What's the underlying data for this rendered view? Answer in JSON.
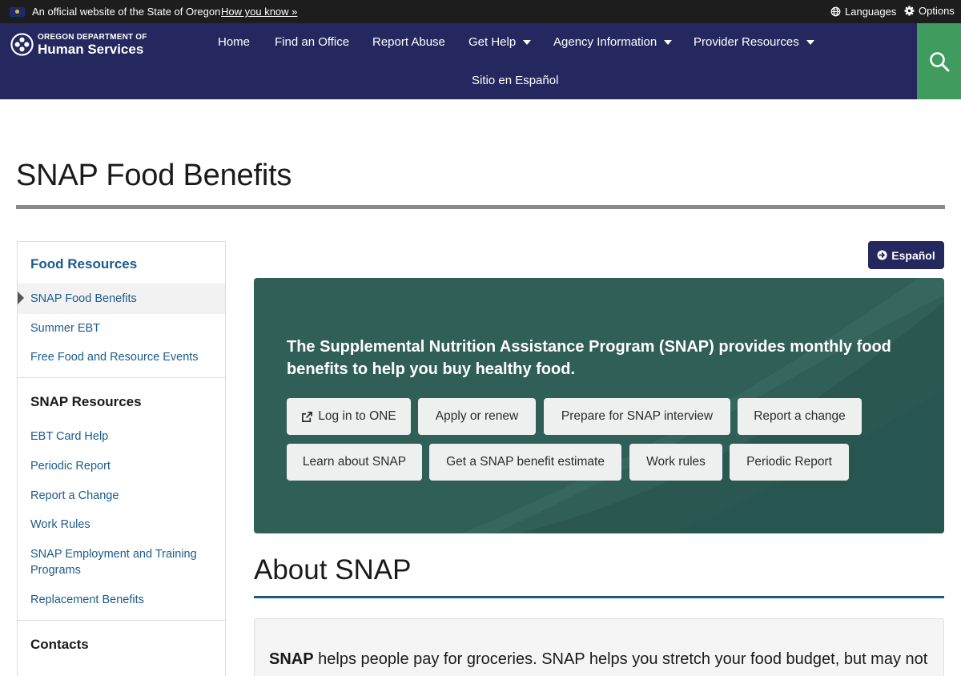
{
  "official_banner": {
    "text": "An official website of the State of Oregon",
    "how_link": "How you know »",
    "languages_label": "Languages",
    "options_label": "Options"
  },
  "header": {
    "logo_top": "OREGON DEPARTMENT OF",
    "logo_bottom": "Human Services",
    "nav": [
      {
        "label": "Home"
      },
      {
        "label": "Find an Office"
      },
      {
        "label": "Report Abuse"
      },
      {
        "label": "Get Help"
      },
      {
        "label": "Agency Information"
      },
      {
        "label": "Provider Resources"
      },
      {
        "label": "Sitio en Español"
      }
    ]
  },
  "page": {
    "title": "SNAP Food Benefits"
  },
  "sidebar": {
    "sections": [
      {
        "heading": "Food Resources",
        "items": [
          {
            "label": "SNAP Food Benefits",
            "active": true
          },
          {
            "label": "Summer EBT"
          },
          {
            "label": "Free Food and Resource Events"
          }
        ]
      },
      {
        "heading": "SNAP Resources",
        "items": [
          {
            "label": "EBT Card Help"
          },
          {
            "label": "Periodic Report"
          },
          {
            "label": "Report a Change"
          },
          {
            "label": "Work Rules"
          },
          {
            "label": "SNAP Employment and Training Programs"
          },
          {
            "label": "Replacement Benefits"
          }
        ]
      },
      {
        "heading": "Contacts",
        "items": []
      }
    ]
  },
  "espanol_button": "Español",
  "hero": {
    "text": "The Supplemental Nutrition Assistance Program (SNAP) provides monthly food benefits to help you buy healthy food.",
    "buttons": [
      {
        "label": "Log in to ONE"
      },
      {
        "label": "Apply or renew"
      },
      {
        "label": "Prepare for SNAP interview"
      },
      {
        "label": "Report a change"
      },
      {
        "label": "Learn about SNAP"
      },
      {
        "label": "Get a SNAP benefit estimate"
      },
      {
        "label": "Work rules"
      },
      {
        "label": "Periodic Report"
      }
    ]
  },
  "about": {
    "title": "About SNAP",
    "lead_bold": "SNAP",
    "lead_text": " helps people pay for groceries. SNAP helps you stretch your food budget, but may not"
  },
  "colors": {
    "header_bg": "#25285e",
    "search_bg": "#3f9b5e",
    "hero_bg": "#305f58",
    "link": "#1b5b8c"
  }
}
